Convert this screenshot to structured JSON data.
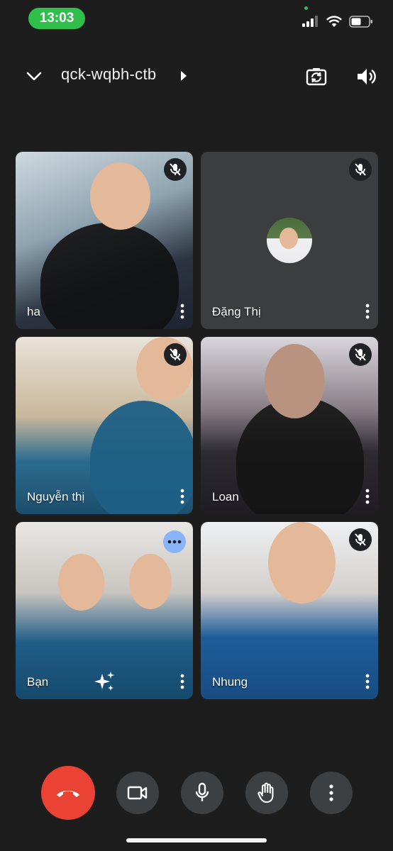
{
  "status_bar": {
    "time": "13:03"
  },
  "header": {
    "meeting_code": "qck-wqbh-ctb"
  },
  "participants": [
    {
      "name": "ha",
      "muted": true
    },
    {
      "name": "Đặng Thị",
      "muted": true,
      "video": false
    },
    {
      "name": "Nguyễn thị",
      "muted": true
    },
    {
      "name": "Loan",
      "muted": true
    },
    {
      "name": "Bạn",
      "muted": false,
      "is_self": true
    },
    {
      "name": "Nhung",
      "muted": true
    }
  ],
  "colors": {
    "end_call": "#ea4335",
    "control_bg": "#3c4043",
    "options_badge": "#8ab4f8",
    "status_time_bg": "#2fbf4a"
  },
  "icons": {
    "header": [
      "chevron-down-icon",
      "play-triangle-icon",
      "switch-camera-icon",
      "speaker-icon"
    ],
    "controls": [
      "end-call-icon",
      "camera-icon",
      "microphone-icon",
      "raise-hand-icon",
      "more-vert-icon"
    ]
  }
}
